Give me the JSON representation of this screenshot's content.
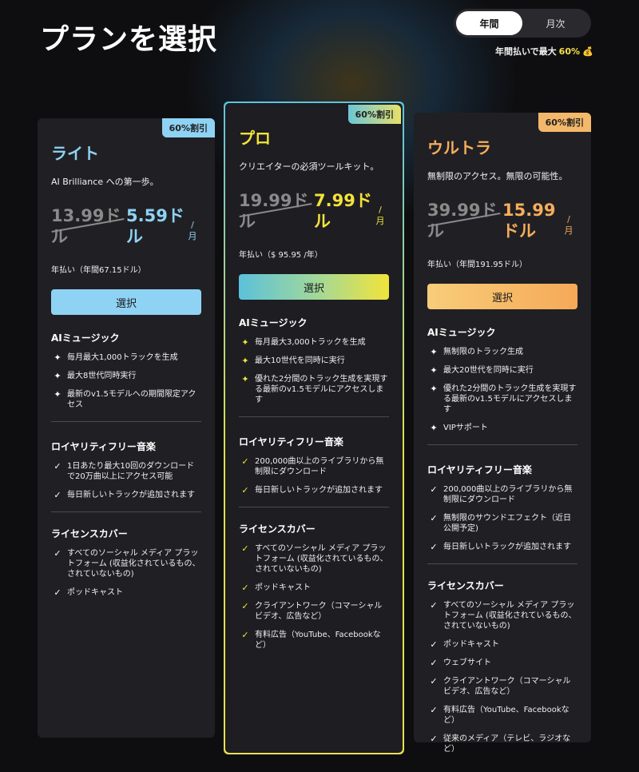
{
  "page": {
    "title": "プランを選択"
  },
  "billing_toggle": {
    "options": [
      {
        "label": "年間",
        "active": true
      },
      {
        "label": "月次",
        "active": false
      }
    ],
    "note_prefix": "年間払いで最大",
    "note_pct": "60%",
    "note_icon": "money-bag-icon"
  },
  "plans": [
    {
      "id": "lite",
      "badge": "60%割引",
      "name": "ライト",
      "tagline": "AI Brilliance への第一歩。",
      "old_price": "13.99ドル",
      "new_price": "5.59ドル",
      "per": "/月",
      "billing": "年払い（年間67.15ドル）",
      "button": "選択",
      "accent": "#8fd3f4",
      "sections": [
        {
          "title": "AIミュージック",
          "icon": "sparkle-icon",
          "items": [
            "毎月最大1,000トラックを生成",
            "最大8世代同時実行",
            "最新のv1.5モデルへの期間限定アクセス"
          ]
        },
        {
          "title": "ロイヤリティフリー音楽",
          "icon": "check-icon",
          "items": [
            "1日あたり最大10回のダウンロードで20万曲以上にアクセス可能",
            "毎日新しいトラックが追加されます"
          ]
        },
        {
          "title": "ライセンスカバー",
          "icon": "check-icon",
          "items": [
            "すべてのソーシャル メディア プラットフォーム (収益化されているもの、されていないもの)",
            "ポッドキャスト"
          ]
        }
      ]
    },
    {
      "id": "pro",
      "badge": "60%割引",
      "name": "プロ",
      "tagline": "クリエイターの必須ツールキット。",
      "old_price": "19.99ドル",
      "new_price": "7.99ドル",
      "per": "/月",
      "billing": "年払い（$ 95.95 /年）",
      "button": "選択",
      "accent": "#f3e33a",
      "sections": [
        {
          "title": "AIミュージック",
          "icon": "sparkle-icon",
          "items": [
            "毎月最大3,000トラックを生成",
            "最大10世代を同時に実行",
            "優れた2分間のトラック生成を実現する最新のv1.5モデルにアクセスします"
          ]
        },
        {
          "title": "ロイヤリティフリー音楽",
          "icon": "check-icon",
          "items": [
            "200,000曲以上のライブラリから無制限にダウンロード",
            "毎日新しいトラックが追加されます"
          ]
        },
        {
          "title": "ライセンスカバー",
          "icon": "check-icon",
          "items": [
            "すべてのソーシャル メディア プラットフォーム (収益化されているもの、されていないもの)",
            "ポッドキャスト",
            "クライアントワーク（コマーシャルビデオ、広告など）",
            "有料広告（YouTube、Facebookなど）"
          ]
        }
      ]
    },
    {
      "id": "ultra",
      "badge": "60%割引",
      "name": "ウルトラ",
      "tagline": "無制限のアクセス。無限の可能性。",
      "old_price": "39.99ドル",
      "new_price": "15.99ドル",
      "per": "/月",
      "billing": "年払い（年間191.95ドル）",
      "button": "選択",
      "accent": "#f6ad5b",
      "sections": [
        {
          "title": "AIミュージック",
          "icon": "sparkle-icon",
          "items": [
            "無制限のトラック生成",
            "最大20世代を同時に実行",
            "優れた2分間のトラック生成を実現する最新のv1.5モデルにアクセスします",
            "VIPサポート"
          ]
        },
        {
          "title": "ロイヤリティフリー音楽",
          "icon": "check-icon",
          "items": [
            "200,000曲以上のライブラリから無制限にダウンロード",
            "無制限のサウンドエフェクト（近日公開予定)",
            "毎日新しいトラックが追加されます"
          ]
        },
        {
          "title": "ライセンスカバー",
          "icon": "check-icon",
          "items": [
            "すべてのソーシャル メディア プラットフォーム (収益化されているもの、されていないもの)",
            "ポッドキャスト",
            "ウェブサイト",
            "クライアントワーク（コマーシャルビデオ、広告など）",
            "有料広告（YouTube、Facebookなど）",
            "従来のメディア（テレビ、ラジオなど）"
          ]
        }
      ]
    }
  ]
}
